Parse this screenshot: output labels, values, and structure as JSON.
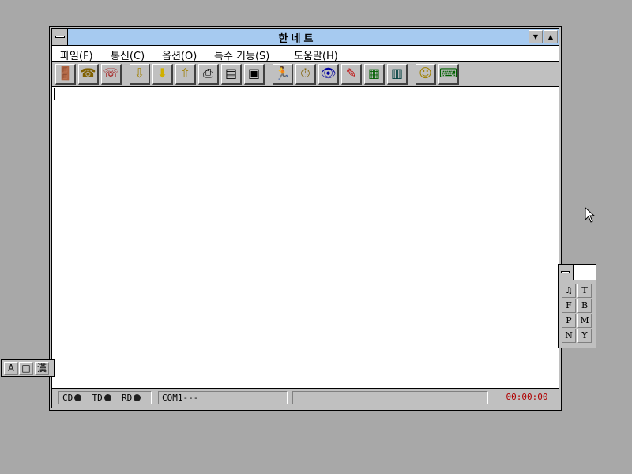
{
  "window": {
    "title": "한네트",
    "minimize_glyph": "▼",
    "maximize_glyph": "▲"
  },
  "menu": [
    {
      "label": "파일(F)"
    },
    {
      "label": "통신(C)"
    },
    {
      "label": "옵션(O)"
    },
    {
      "label": "특수 기능(S)"
    },
    {
      "label": "도움말(H)"
    }
  ],
  "toolbar": [
    {
      "icon": "exit-door-icon",
      "glyph": "🚪"
    },
    {
      "icon": "phone-dial-icon",
      "glyph": "☎"
    },
    {
      "icon": "hangup-icon",
      "glyph": "☏"
    },
    {
      "icon": "download-icon",
      "glyph": "⇩"
    },
    {
      "icon": "download-arrow-icon",
      "glyph": "⬇"
    },
    {
      "icon": "upload-icon",
      "glyph": "⇧"
    },
    {
      "icon": "printer-icon",
      "glyph": "⎙"
    },
    {
      "icon": "capture-icon",
      "glyph": "▤"
    },
    {
      "icon": "scroll-icon",
      "glyph": "▣"
    },
    {
      "icon": "runner-icon",
      "glyph": "🏃"
    },
    {
      "icon": "clock-icon",
      "glyph": "⏱"
    },
    {
      "icon": "eye-icon",
      "glyph": "👁"
    },
    {
      "icon": "eraser-icon",
      "glyph": "✎"
    },
    {
      "icon": "picture-icon",
      "glyph": "▦"
    },
    {
      "icon": "calculator-icon",
      "glyph": "▥"
    },
    {
      "icon": "help-face-icon",
      "glyph": "☺"
    },
    {
      "icon": "keyboard-icon",
      "glyph": "⌨"
    }
  ],
  "status": {
    "cd_label": "CD",
    "td_label": "TD",
    "rd_label": "RD",
    "port": "COM1---",
    "timer": "00:00:00",
    "timer_color": "#b00000"
  },
  "palette": {
    "buttons": [
      "♫",
      "T",
      "F",
      "B",
      "P",
      "M",
      "N",
      "Y"
    ]
  },
  "ime": {
    "buttons": [
      "A",
      "□",
      "漢"
    ]
  },
  "colors": {
    "desktop": "#a8a8a8",
    "titlebar": "#a6caf0",
    "face": "#c0c0c0"
  }
}
